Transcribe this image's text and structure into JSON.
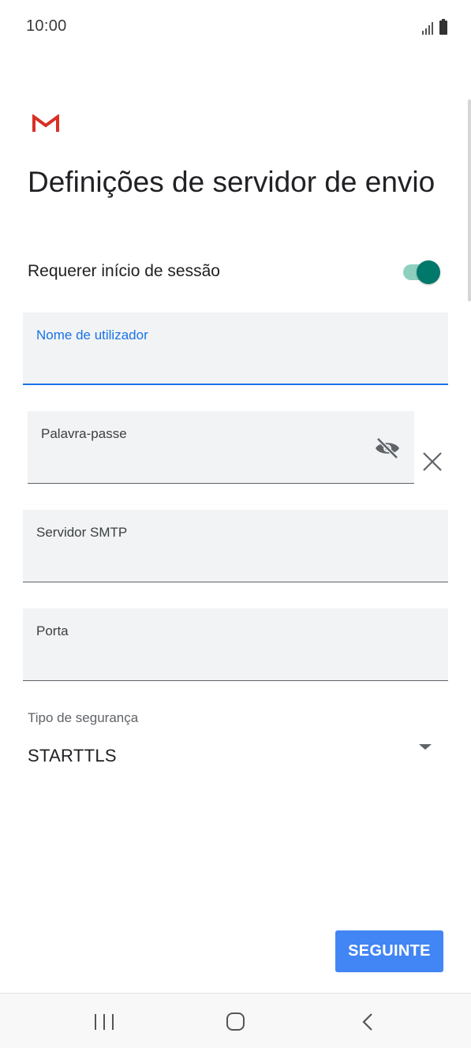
{
  "status_bar": {
    "time": "10:00"
  },
  "header": {
    "logo_icon": "gmail-logo",
    "title": "Definições de servidor de envio"
  },
  "require_login": {
    "label": "Requerer início de sessão",
    "enabled": true,
    "accent_color": "#00796b"
  },
  "fields": {
    "username": {
      "label": "Nome de utilizador",
      "value": "",
      "focused": true
    },
    "password": {
      "label": "Palavra-passe",
      "value": ""
    },
    "smtp_server": {
      "label": "Servidor SMTP",
      "value": ""
    },
    "port": {
      "label": "Porta",
      "value": ""
    }
  },
  "security_type": {
    "label": "Tipo de segurança",
    "selected": "STARTTLS"
  },
  "actions": {
    "next_label": "SEGUINTE",
    "next_color": "#4285f4"
  },
  "navigation": {
    "icons": [
      "recent-apps-icon",
      "home-icon",
      "back-icon"
    ]
  }
}
